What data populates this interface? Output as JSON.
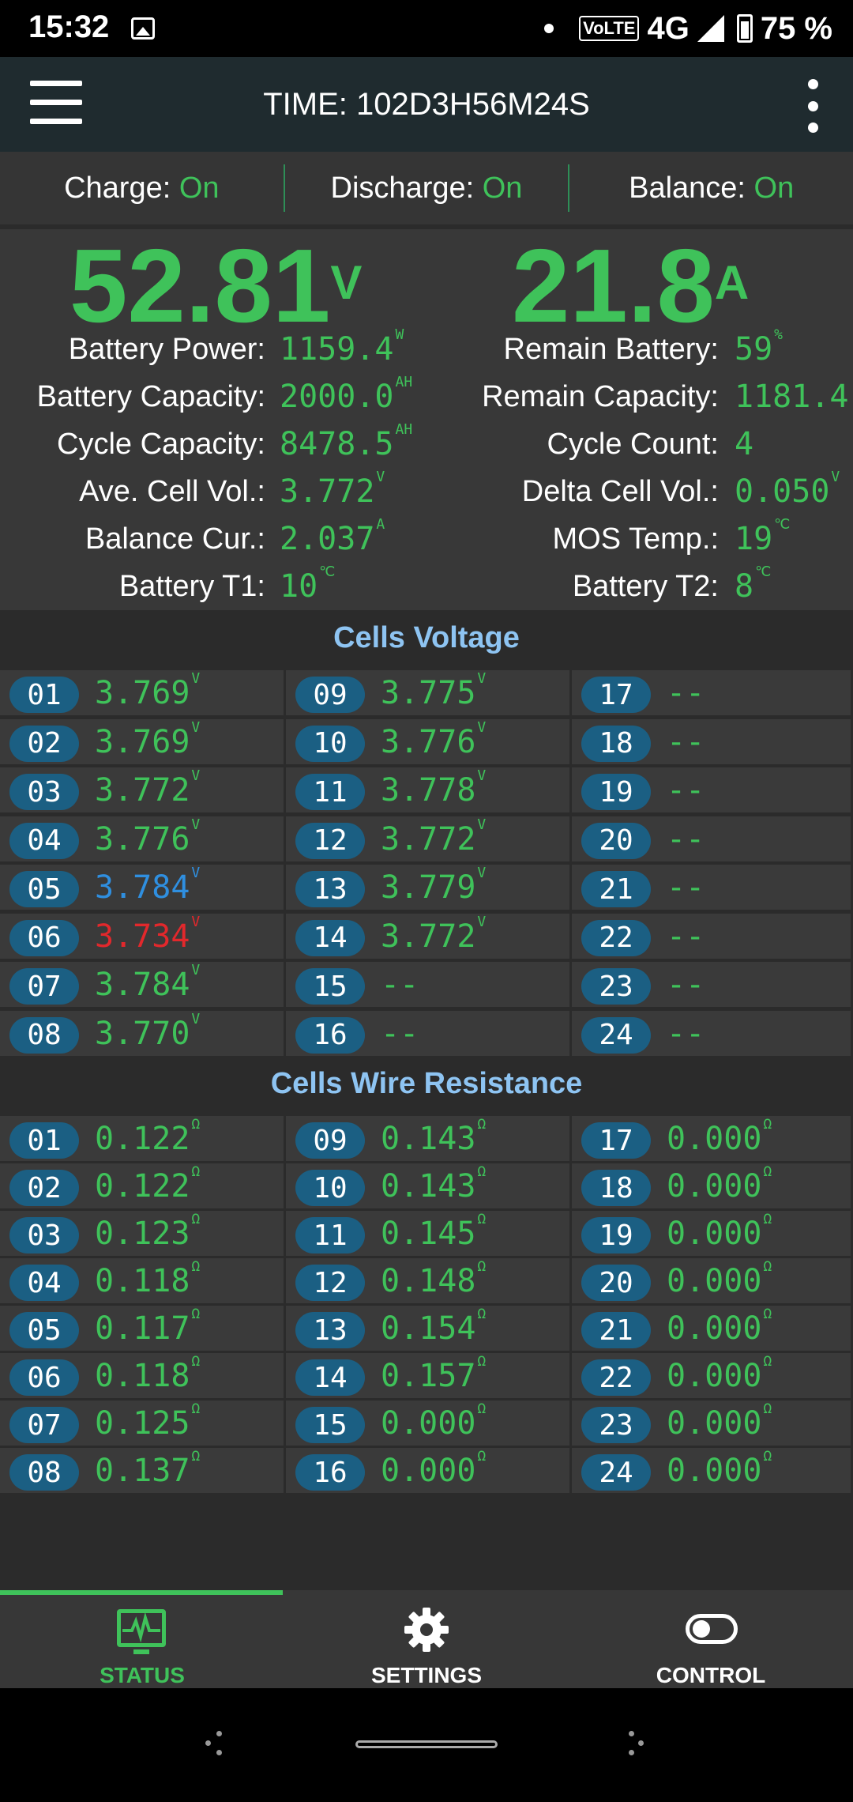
{
  "status_bar": {
    "time": "15:32",
    "network": "4G",
    "volte": "VoLTE",
    "battery": "75 %"
  },
  "app_bar": {
    "title": "TIME: 102D3H56M24S"
  },
  "switches": [
    {
      "label": "Charge:",
      "value": "On"
    },
    {
      "label": "Discharge:",
      "value": "On"
    },
    {
      "label": "Balance:",
      "value": "On"
    }
  ],
  "main": {
    "voltage": "52.81",
    "voltage_unit": "V",
    "current": "21.8",
    "current_unit": "A"
  },
  "stats_left": [
    {
      "label": "Battery Power:",
      "value": "1159.4",
      "unit": "W"
    },
    {
      "label": "Battery Capacity:",
      "value": "2000.0",
      "unit": "AH"
    },
    {
      "label": "Cycle Capacity:",
      "value": "8478.5",
      "unit": "AH"
    },
    {
      "label": "Ave. Cell Vol.:",
      "value": "3.772",
      "unit": "V"
    },
    {
      "label": "Balance Cur.:",
      "value": "2.037",
      "unit": "A"
    },
    {
      "label": "Battery T1:",
      "value": "10",
      "unit": "℃"
    }
  ],
  "stats_right": [
    {
      "label": "Remain Battery:",
      "value": "59",
      "unit": "%"
    },
    {
      "label": "Remain Capacity:",
      "value": "1181.4",
      "unit": ""
    },
    {
      "label": "Cycle Count:",
      "value": "4",
      "unit": ""
    },
    {
      "label": "Delta Cell Vol.:",
      "value": "0.050",
      "unit": "V"
    },
    {
      "label": "MOS Temp.:",
      "value": "19",
      "unit": "℃"
    },
    {
      "label": "Battery T2:",
      "value": "8",
      "unit": "℃"
    }
  ],
  "cells_voltage": {
    "title": "Cells Voltage",
    "cells": [
      {
        "id": "01",
        "value": "3.769",
        "unit": "V",
        "state": "normal"
      },
      {
        "id": "09",
        "value": "3.775",
        "unit": "V",
        "state": "normal"
      },
      {
        "id": "17",
        "value": "--",
        "unit": "",
        "state": "normal"
      },
      {
        "id": "02",
        "value": "3.769",
        "unit": "V",
        "state": "normal"
      },
      {
        "id": "10",
        "value": "3.776",
        "unit": "V",
        "state": "normal"
      },
      {
        "id": "18",
        "value": "--",
        "unit": "",
        "state": "normal"
      },
      {
        "id": "03",
        "value": "3.772",
        "unit": "V",
        "state": "normal"
      },
      {
        "id": "11",
        "value": "3.778",
        "unit": "V",
        "state": "normal"
      },
      {
        "id": "19",
        "value": "--",
        "unit": "",
        "state": "normal"
      },
      {
        "id": "04",
        "value": "3.776",
        "unit": "V",
        "state": "normal"
      },
      {
        "id": "12",
        "value": "3.772",
        "unit": "V",
        "state": "normal"
      },
      {
        "id": "20",
        "value": "--",
        "unit": "",
        "state": "normal"
      },
      {
        "id": "05",
        "value": "3.784",
        "unit": "V",
        "state": "max"
      },
      {
        "id": "13",
        "value": "3.779",
        "unit": "V",
        "state": "normal"
      },
      {
        "id": "21",
        "value": "--",
        "unit": "",
        "state": "normal"
      },
      {
        "id": "06",
        "value": "3.734",
        "unit": "V",
        "state": "min"
      },
      {
        "id": "14",
        "value": "3.772",
        "unit": "V",
        "state": "normal"
      },
      {
        "id": "22",
        "value": "--",
        "unit": "",
        "state": "normal"
      },
      {
        "id": "07",
        "value": "3.784",
        "unit": "V",
        "state": "normal"
      },
      {
        "id": "15",
        "value": "--",
        "unit": "",
        "state": "normal"
      },
      {
        "id": "23",
        "value": "--",
        "unit": "",
        "state": "normal"
      },
      {
        "id": "08",
        "value": "3.770",
        "unit": "V",
        "state": "normal"
      },
      {
        "id": "16",
        "value": "--",
        "unit": "",
        "state": "normal"
      },
      {
        "id": "24",
        "value": "--",
        "unit": "",
        "state": "normal"
      }
    ]
  },
  "cells_resistance": {
    "title": "Cells Wire Resistance",
    "cells": [
      {
        "id": "01",
        "value": "0.122",
        "unit": "Ω"
      },
      {
        "id": "09",
        "value": "0.143",
        "unit": "Ω"
      },
      {
        "id": "17",
        "value": "0.000",
        "unit": "Ω"
      },
      {
        "id": "02",
        "value": "0.122",
        "unit": "Ω"
      },
      {
        "id": "10",
        "value": "0.143",
        "unit": "Ω"
      },
      {
        "id": "18",
        "value": "0.000",
        "unit": "Ω"
      },
      {
        "id": "03",
        "value": "0.123",
        "unit": "Ω"
      },
      {
        "id": "11",
        "value": "0.145",
        "unit": "Ω"
      },
      {
        "id": "19",
        "value": "0.000",
        "unit": "Ω"
      },
      {
        "id": "04",
        "value": "0.118",
        "unit": "Ω"
      },
      {
        "id": "12",
        "value": "0.148",
        "unit": "Ω"
      },
      {
        "id": "20",
        "value": "0.000",
        "unit": "Ω"
      },
      {
        "id": "05",
        "value": "0.117",
        "unit": "Ω"
      },
      {
        "id": "13",
        "value": "0.154",
        "unit": "Ω"
      },
      {
        "id": "21",
        "value": "0.000",
        "unit": "Ω"
      },
      {
        "id": "06",
        "value": "0.118",
        "unit": "Ω"
      },
      {
        "id": "14",
        "value": "0.157",
        "unit": "Ω"
      },
      {
        "id": "22",
        "value": "0.000",
        "unit": "Ω"
      },
      {
        "id": "07",
        "value": "0.125",
        "unit": "Ω"
      },
      {
        "id": "15",
        "value": "0.000",
        "unit": "Ω"
      },
      {
        "id": "23",
        "value": "0.000",
        "unit": "Ω"
      },
      {
        "id": "08",
        "value": "0.137",
        "unit": "Ω"
      },
      {
        "id": "16",
        "value": "0.000",
        "unit": "Ω"
      },
      {
        "id": "24",
        "value": "0.000",
        "unit": "Ω"
      }
    ]
  },
  "bottom_nav": [
    {
      "label": "STATUS",
      "icon": "monitor-heartbeat-icon",
      "active": true
    },
    {
      "label": "SETTINGS",
      "icon": "gear-icon",
      "active": false
    },
    {
      "label": "CONTROL",
      "icon": "toggle-icon",
      "active": false
    }
  ],
  "colors": {
    "accent": "#3fc25a",
    "max_cell": "#2f8fe0",
    "min_cell": "#e2282c",
    "section_title": "#8ec4f2",
    "badge": "#1b5f83"
  }
}
